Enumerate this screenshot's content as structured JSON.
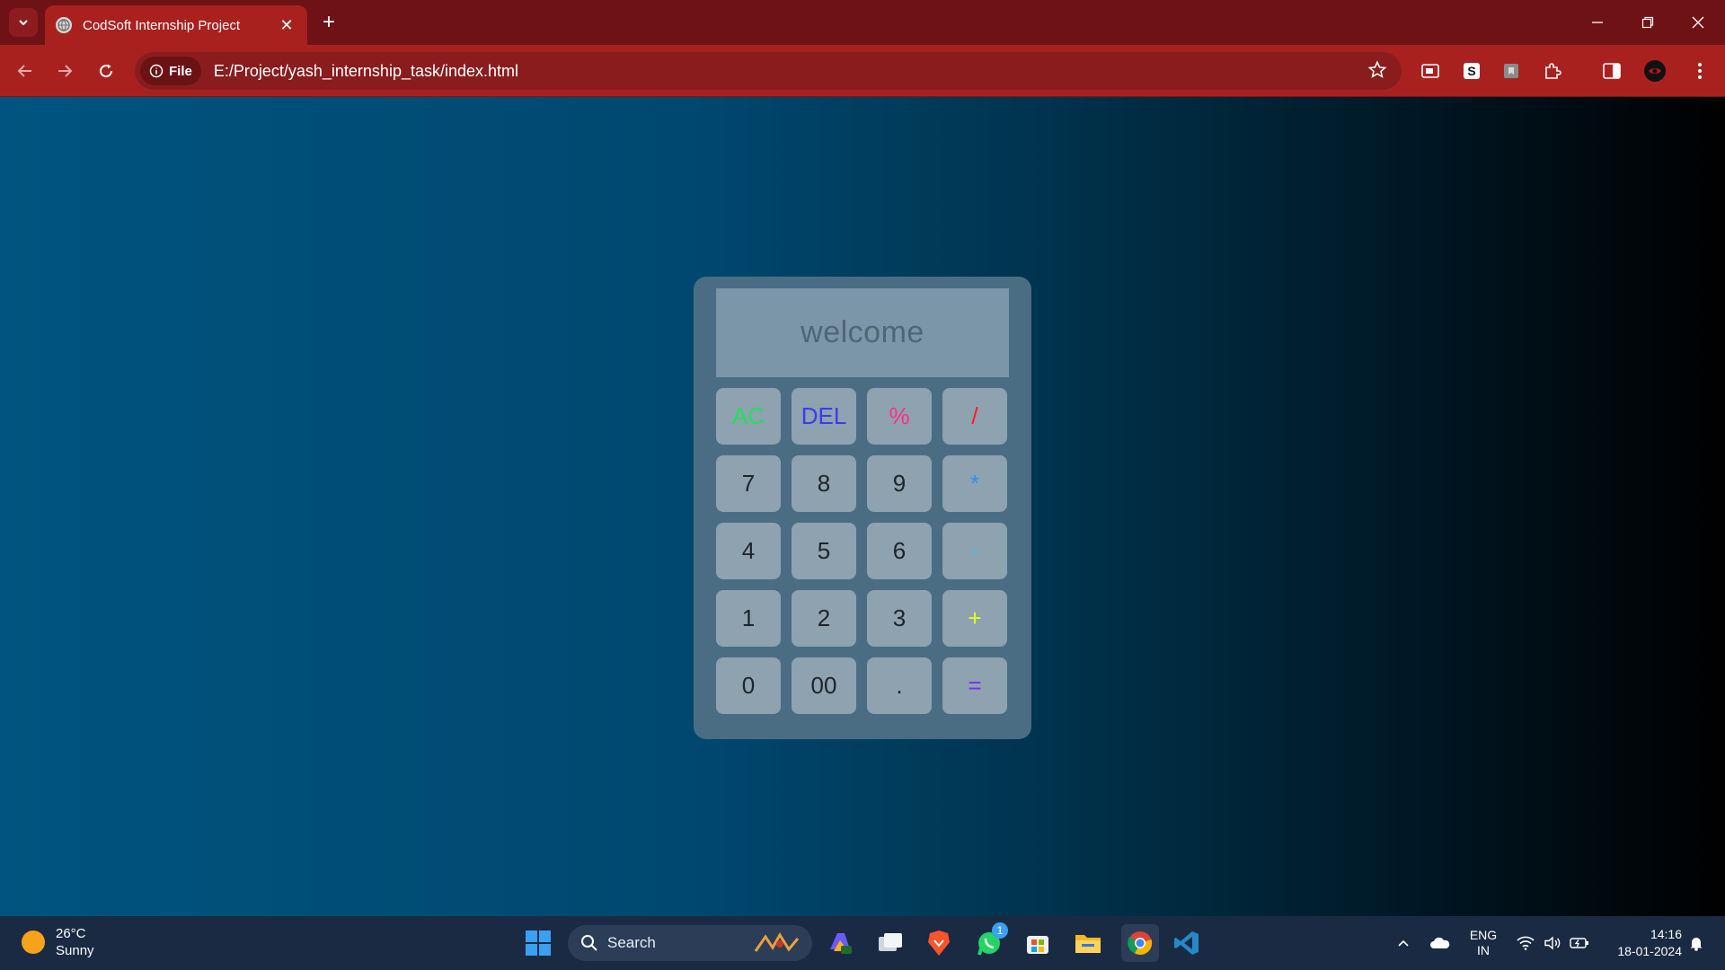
{
  "browser": {
    "tab_title": "CodSoft Internship Project",
    "url_chip": "File",
    "url": "E:/Project/yash_internship_task/index.html"
  },
  "calculator": {
    "display": "welcome",
    "keys": [
      {
        "label": "AC",
        "color": "#22e05a"
      },
      {
        "label": "DEL",
        "color": "#3b3bf0"
      },
      {
        "label": "%",
        "color": "#ff2f86"
      },
      {
        "label": "/",
        "color": "#ff1a1a"
      },
      {
        "label": "7",
        "color": "#1f2428"
      },
      {
        "label": "8",
        "color": "#1f2428"
      },
      {
        "label": "9",
        "color": "#1f2428"
      },
      {
        "label": "*",
        "color": "#2f8cff"
      },
      {
        "label": "4",
        "color": "#1f2428"
      },
      {
        "label": "5",
        "color": "#1f2428"
      },
      {
        "label": "6",
        "color": "#1f2428"
      },
      {
        "label": "-",
        "color": "#2fc6ff"
      },
      {
        "label": "1",
        "color": "#1f2428"
      },
      {
        "label": "2",
        "color": "#1f2428"
      },
      {
        "label": "3",
        "color": "#1f2428"
      },
      {
        "label": "+",
        "color": "#e6ff1a"
      },
      {
        "label": "0",
        "color": "#1f2428"
      },
      {
        "label": "00",
        "color": "#1f2428"
      },
      {
        "label": ".",
        "color": "#1f2428"
      },
      {
        "label": "=",
        "color": "#7a2cff"
      }
    ]
  },
  "taskbar": {
    "temperature": "26°C",
    "weather": "Sunny",
    "search_label": "Search",
    "whatsapp_badge": "1",
    "lang_top": "ENG",
    "lang_bottom": "IN",
    "time": "14:16",
    "date": "18-01-2024"
  },
  "colors": {
    "tabbar": "#6e1216",
    "toolbar": "#a9211f",
    "calculator_body": "#4a6d84",
    "display": "#7b96a8",
    "key": "#8ea2b0"
  }
}
